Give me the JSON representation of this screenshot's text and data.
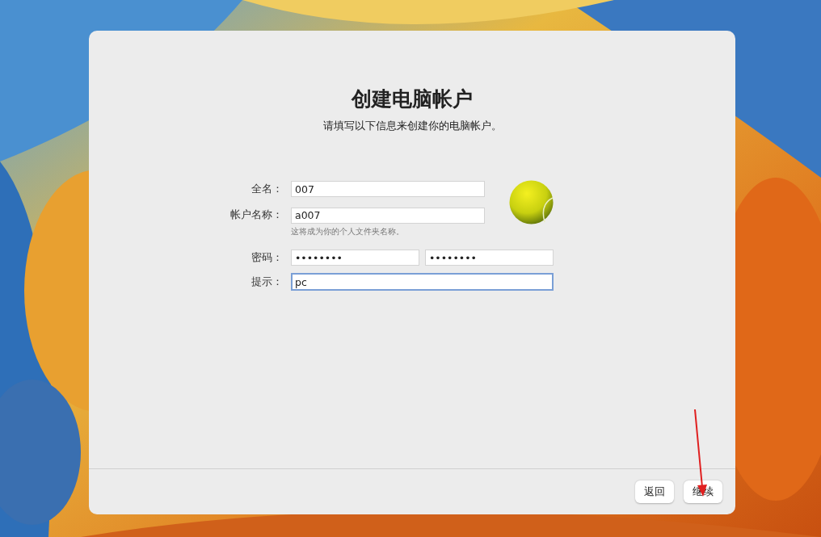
{
  "title": "创建电脑帐户",
  "subtitle": "请填写以下信息来创建你的电脑帐户。",
  "fields": [
    {
      "label": "全名：",
      "kind": "short",
      "inputs": [
        {
          "value": "007",
          "focused": false
        }
      ]
    },
    {
      "label": "帐户名称：",
      "kind": "short",
      "inputs": [
        {
          "value": "a007",
          "focused": false
        }
      ],
      "note": "这将成为你的个人文件夹名称。"
    },
    {
      "label": "密码：",
      "kind": "wide",
      "inputs": [
        {
          "value": "••••••••",
          "focused": false
        },
        {
          "value": "••••••••",
          "focused": false
        }
      ]
    },
    {
      "label": "提示：",
      "kind": "wide",
      "inputs": [
        {
          "value": "pc",
          "focused": true
        }
      ]
    }
  ],
  "buttons": [
    {
      "label": "返回"
    },
    {
      "label": "继续"
    }
  ]
}
